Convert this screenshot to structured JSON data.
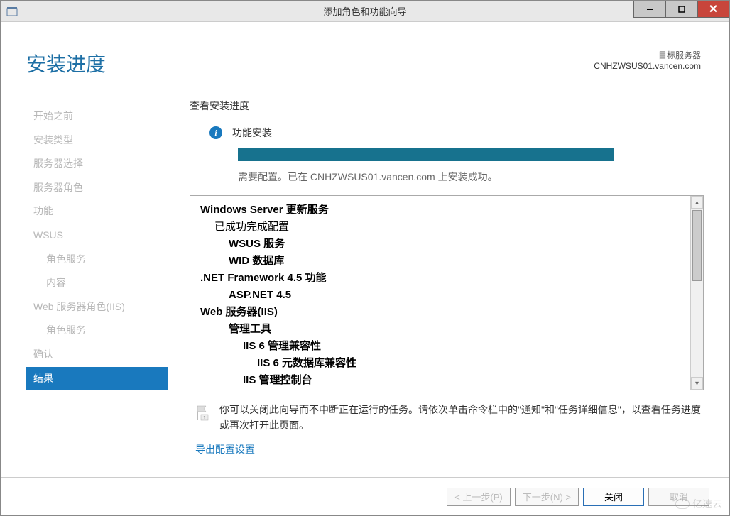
{
  "window": {
    "title": "添加角色和功能向导"
  },
  "header": {
    "heading": "安装进度",
    "destLabel": "目标服务器",
    "destName": "CNHZWSUS01.vancen.com"
  },
  "sidebar": {
    "items": [
      {
        "label": "开始之前",
        "sub": false,
        "active": false
      },
      {
        "label": "安装类型",
        "sub": false,
        "active": false
      },
      {
        "label": "服务器选择",
        "sub": false,
        "active": false
      },
      {
        "label": "服务器角色",
        "sub": false,
        "active": false
      },
      {
        "label": "功能",
        "sub": false,
        "active": false
      },
      {
        "label": "WSUS",
        "sub": false,
        "active": false
      },
      {
        "label": "角色服务",
        "sub": true,
        "active": false
      },
      {
        "label": "内容",
        "sub": true,
        "active": false
      },
      {
        "label": "Web 服务器角色(IIS)",
        "sub": false,
        "active": false
      },
      {
        "label": "角色服务",
        "sub": true,
        "active": false
      },
      {
        "label": "确认",
        "sub": false,
        "active": false
      },
      {
        "label": "结果",
        "sub": false,
        "active": true
      }
    ]
  },
  "main": {
    "sectionTitle": "查看安装进度",
    "statusLabel": "功能安装",
    "statusMessage": "需要配置。已在 CNHZWSUS01.vancen.com 上安装成功。",
    "results": [
      {
        "text": "Windows Server 更新服务",
        "bold": true,
        "level": 0
      },
      {
        "text": "已成功完成配置",
        "bold": false,
        "level": 1
      },
      {
        "text": "WSUS 服务",
        "bold": true,
        "level": 2
      },
      {
        "text": "WID 数据库",
        "bold": true,
        "level": 2
      },
      {
        "text": ".NET Framework 4.5 功能",
        "bold": true,
        "level": 0
      },
      {
        "text": "ASP.NET 4.5",
        "bold": true,
        "level": 2
      },
      {
        "text": "Web 服务器(IIS)",
        "bold": true,
        "level": 0
      },
      {
        "text": "管理工具",
        "bold": true,
        "level": 2
      },
      {
        "text": "IIS 6 管理兼容性",
        "bold": true,
        "level": 3
      },
      {
        "text": "IIS 6 元数据库兼容性",
        "bold": true,
        "level": 4
      },
      {
        "text": "IIS 管理控制台",
        "bold": true,
        "level": 3
      }
    ],
    "noteText": "你可以关闭此向导而不中断正在运行的任务。请依次单击命令栏中的\"通知\"和\"任务详细信息\"，以查看任务进度或再次打开此页面。",
    "exportLink": "导出配置设置"
  },
  "footer": {
    "prev": "< 上一步(P)",
    "next": "下一步(N) >",
    "close": "关闭",
    "cancel": "取消"
  },
  "watermark": "亿速云"
}
